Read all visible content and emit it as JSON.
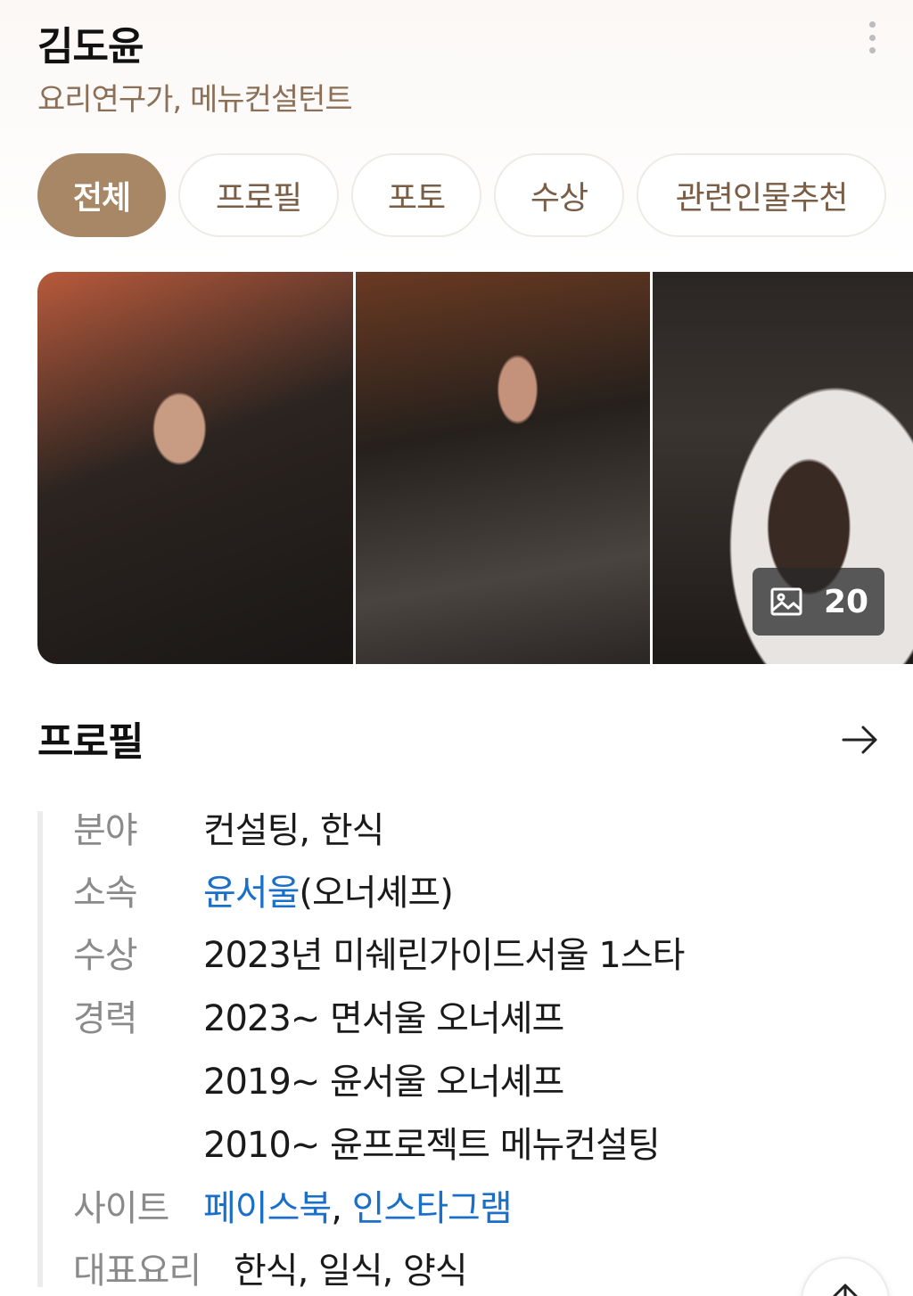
{
  "header": {
    "name": "김도윤",
    "subtitle": "요리연구가, 메뉴컨설턴트",
    "more_icon": "more-vertical-icon"
  },
  "tabs": [
    {
      "label": "전체",
      "active": true
    },
    {
      "label": "프로필",
      "active": false
    },
    {
      "label": "포토",
      "active": false
    },
    {
      "label": "수상",
      "active": false
    },
    {
      "label": "관련인물추천",
      "active": false
    }
  ],
  "photos": {
    "count": "20",
    "count_icon": "image-icon"
  },
  "profile": {
    "title": "프로필",
    "arrow_icon": "arrow-right-icon",
    "rows": {
      "field": {
        "label": "분야",
        "value": "컨설팅, 한식"
      },
      "affiliation": {
        "label": "소속",
        "link": "윤서울",
        "suffix": "(오너셰프)"
      },
      "award": {
        "label": "수상",
        "value": "2023년 미쉐린가이드서울 1스타"
      },
      "career": {
        "label": "경력",
        "items": [
          "2023~ 면서울 오너셰프",
          "2019~ 윤서울 오너셰프",
          "2010~ 윤프로젝트 메뉴컨설팅"
        ]
      },
      "site": {
        "label": "사이트",
        "links": [
          "페이스북",
          "인스타그램"
        ],
        "separator": ","
      },
      "signature": {
        "label": "대표요리",
        "value": "한식, 일식, 양식"
      }
    }
  },
  "colors": {
    "accent": "#a88766",
    "subtitle": "#8b6f57",
    "link": "#1a6fc9"
  }
}
